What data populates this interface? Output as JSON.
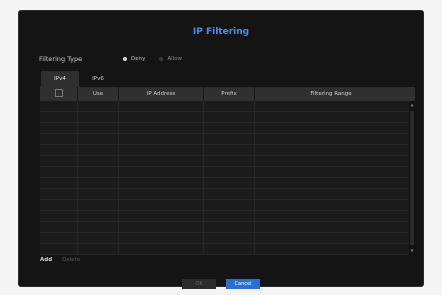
{
  "dialog": {
    "title": "IP Filtering"
  },
  "filtering_type": {
    "label": "Filtering Type",
    "options": [
      {
        "label": "Deny",
        "selected": true
      },
      {
        "label": "Allow",
        "selected": false
      }
    ]
  },
  "tabs": [
    {
      "label": "IPv4",
      "active": true
    },
    {
      "label": "IPv6",
      "active": false
    }
  ],
  "table": {
    "columns": [
      "",
      "Use",
      "IP Address",
      "Prefix",
      "Filtering Range"
    ],
    "rows": [
      [],
      [],
      [],
      [],
      [],
      [],
      [],
      [],
      [],
      [],
      [],
      [],
      [],
      []
    ]
  },
  "actions": {
    "add": "Add",
    "delete": "Delete"
  },
  "footer": {
    "ok": "OK",
    "cancel": "Cancel"
  },
  "colors": {
    "accent": "#4f8fe0",
    "primary_button": "#2d6fd0",
    "background": "#141414"
  }
}
